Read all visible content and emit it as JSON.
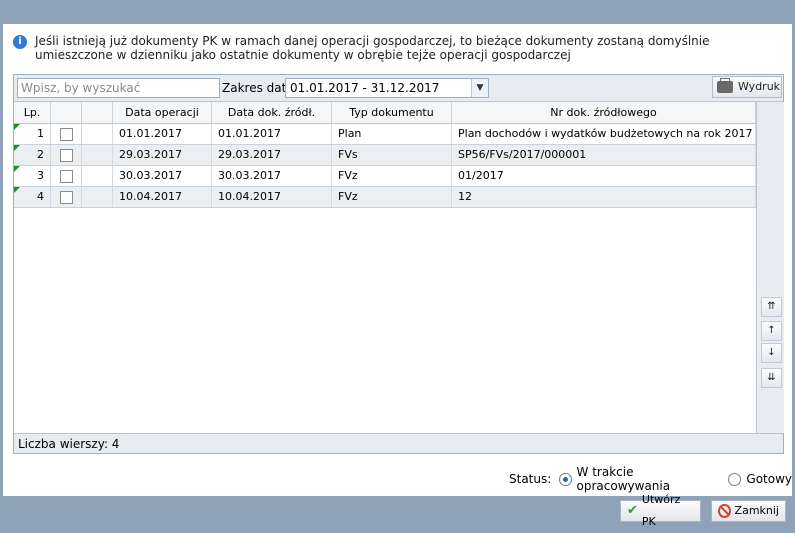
{
  "info": {
    "text": "Jeśli istnieją już dokumenty PK w ramach danej operacji gospodarczej, to bieżące dokumenty zostaną domyślnie umieszczone w dzienniku jako ostatnie dokumenty w obrębie tejże operacji gospodarczej"
  },
  "toolbar": {
    "search_placeholder": "Wpisz, by wyszukać",
    "range_label": "Zakres dat:",
    "range_value": "01.01.2017 - 31.12.2017",
    "print_label": "Wydruk"
  },
  "grid": {
    "columns": [
      "Lp.",
      "",
      "",
      "Data operacji",
      "Data dok. źródł.",
      "Typ dokumentu",
      "Nr dok. źródłowego"
    ],
    "rows": [
      {
        "lp": "1",
        "data_op": "01.01.2017",
        "data_dok": "01.01.2017",
        "typ": "Plan",
        "nr": "Plan dochodów i wydatków budżetowych na rok 2017"
      },
      {
        "lp": "2",
        "data_op": "29.03.2017",
        "data_dok": "29.03.2017",
        "typ": "FVs",
        "nr": "SP56/FVs/2017/000001"
      },
      {
        "lp": "3",
        "data_op": "30.03.2017",
        "data_dok": "30.03.2017",
        "typ": "FVz",
        "nr": "01/2017"
      },
      {
        "lp": "4",
        "data_op": "10.04.2017",
        "data_dok": "10.04.2017",
        "typ": "FVz",
        "nr": "12"
      }
    ],
    "row_count_label": "Liczba wierszy: 4"
  },
  "status": {
    "label": "Status:",
    "options": [
      {
        "label": "W trakcie opracowywania",
        "selected": true
      },
      {
        "label": "Gotowy",
        "selected": false
      }
    ]
  },
  "buttons": {
    "create": "Utwórz PK",
    "close": "Zamknij"
  }
}
